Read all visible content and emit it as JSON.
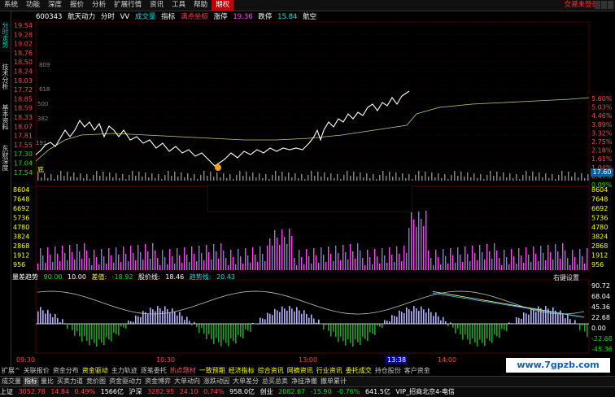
{
  "menu": {
    "items": [
      "系统",
      "功能",
      "深度",
      "报价",
      "分析",
      "扩展行情",
      "资讯",
      "工具",
      "帮助",
      "期权"
    ],
    "selected_index": 9,
    "right_text": "交易未登录"
  },
  "sidebar": {
    "tabs": [
      "分时走势",
      "技术分析",
      "基本资料",
      "东财深度"
    ]
  },
  "header": {
    "code": "600343",
    "name": "航天动力",
    "mode": "分时",
    "vv": "VV",
    "volume_label": "成交量",
    "indicator": "指标",
    "point_label": "满点坐标",
    "limit_up_label": "涨停",
    "limit_up_value": "19.36",
    "limit_down_label": "跌停",
    "limit_down_value": "15.84",
    "tag": "航空"
  },
  "chart": {
    "price_ticks": [
      "19.54",
      "19.28",
      "19.02",
      "18.76",
      "18.50",
      "18.24",
      "17.98",
      "17.72",
      "17.46",
      "17.20",
      "16.94",
      "16.68",
      "16.42",
      "16.16",
      "15.90",
      "15.64",
      "15.38"
    ],
    "left_price_ticks": [
      "19.54",
      "19.28",
      "19.02",
      "18.76",
      "18.50",
      "18.24",
      "18.03",
      "17.72",
      "18.85",
      "18.59",
      "18.33",
      "18.07",
      "17.81",
      "17.55",
      "17.30",
      "17.04",
      "17.54"
    ],
    "pct_ticks": [
      "5.60%",
      "5.03%",
      "4.46%",
      "3.89%",
      "3.32%",
      "2.75%",
      "2.18%",
      "1.61%",
      "1.04%",
      "0.47%",
      "0.09%"
    ],
    "current_price": "17.60",
    "inner_labels": [
      "809",
      "618",
      "500",
      "382",
      "191"
    ],
    "low_marker": "底",
    "volume_ticks": [
      "8604",
      "7648",
      "6692",
      "5736",
      "4780",
      "3824",
      "2868",
      "1912",
      "956"
    ],
    "indicator_ticks": [
      "90.72",
      "68.04",
      "45.36",
      "22.68",
      "0.00",
      "-22.68",
      "-45.36"
    ],
    "time_ticks": [
      "09:30",
      "10:30",
      "13:00",
      "13:38",
      "14:00"
    ]
  },
  "sub_header": {
    "title": "量差趋势",
    "v1_label": "90.00",
    "v2": "10.00",
    "diff_label": "差值:",
    "diff_value": "-18.92",
    "stock_label": "股价线:",
    "stock_value": "18.46",
    "trend_label": "趋势线:",
    "trend_value": "20.43",
    "right": "右键设置"
  },
  "tabs": [
    {
      "label": "成交量",
      "style": ""
    },
    {
      "label": "指标",
      "style": "sel"
    },
    {
      "label": "量比",
      "style": ""
    },
    {
      "label": "买卖力道",
      "style": ""
    },
    {
      "label": "竞价图",
      "style": ""
    },
    {
      "label": "资金驱动力",
      "style": ""
    },
    {
      "label": "资金博弈",
      "style": ""
    },
    {
      "label": "大单动向",
      "style": ""
    },
    {
      "label": "涨跌动因",
      "style": ""
    },
    {
      "label": "大单差分",
      "style": ""
    },
    {
      "label": "总买总卖",
      "style": ""
    },
    {
      "label": "净挂净撤",
      "style": ""
    },
    {
      "label": "撤单累计",
      "style": ""
    }
  ],
  "tabs2": [
    {
      "label": "扩展^",
      "style": ""
    },
    {
      "label": "关联报价",
      "style": ""
    },
    {
      "label": "资金分布",
      "style": ""
    },
    {
      "label": "资金驱动",
      "style": "y"
    },
    {
      "label": "主力轨迹",
      "style": ""
    },
    {
      "label": "逐笔委托",
      "style": ""
    },
    {
      "label": "热点题材",
      "style": "r"
    },
    {
      "label": "一致预期",
      "style": "y"
    },
    {
      "label": "经济指标",
      "style": "y"
    },
    {
      "label": "综合资讯",
      "style": "y"
    },
    {
      "label": "网摘资讯",
      "style": "y"
    },
    {
      "label": "行业资讯",
      "style": "y"
    },
    {
      "label": "委托成交",
      "style": "y"
    },
    {
      "label": "持仓股份",
      "style": ""
    },
    {
      "label": "客户资金",
      "style": ""
    }
  ],
  "status": {
    "sh_label": "上证",
    "sh_value": "3052.78",
    "sh_chg": "14.84",
    "sh_pct": "0.49%",
    "sh_amt": "1566亿",
    "hs_label": "沪深",
    "hs_value": "3282.95",
    "hs_chg": "24.10",
    "hs_pct": "0.74%",
    "hs_amt": "958.0亿",
    "cy_label": "创业",
    "cy_value": "2082.67",
    "cy_chg": "-15.90",
    "cy_pct": "-0.76%",
    "cy_amt": "641.5亿",
    "vip": "VIP_招商北京4-电信"
  },
  "watermark": "www.7gpzb.com",
  "colors": {
    "up": "#ff4040",
    "down": "#00e000",
    "price_line": "#ffffff",
    "avg_line": "#c8c870",
    "volume_up": "#ff40ff",
    "volume_down": "#8080c0"
  }
}
